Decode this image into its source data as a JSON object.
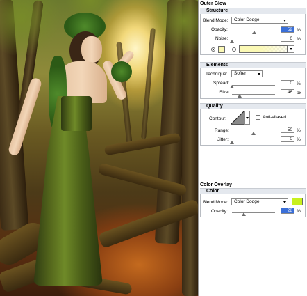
{
  "panel": {
    "outer_glow": {
      "title": "Outer Glow",
      "structure": {
        "header": "Structure",
        "blend_mode_label": "Blend Mode:",
        "blend_mode_value": "Color Dodge",
        "opacity_label": "Opacity:",
        "opacity_value": "52",
        "opacity_unit": "%",
        "opacity_level": 0.52,
        "noise_label": "Noise:",
        "noise_value": "0",
        "noise_unit": "%",
        "noise_level": 0,
        "glow_color": "#fbf9b5",
        "gradient_color": "#fbf9b5",
        "color_radio_selected": true
      },
      "elements": {
        "header": "Elements",
        "technique_label": "Technique:",
        "technique_value": "Softer",
        "spread_label": "Spread:",
        "spread_value": "0",
        "spread_unit": "%",
        "spread_level": 0,
        "size_label": "Size:",
        "size_value": "46",
        "size_unit": "px",
        "size_level": 0.18
      },
      "quality": {
        "header": "Quality",
        "contour_label": "Contour:",
        "anti_aliased_label": "Anti-aliased",
        "anti_aliased_checked": false,
        "range_label": "Range:",
        "range_value": "50",
        "range_unit": "%",
        "range_level": 0.5,
        "jitter_label": "Jitter:",
        "jitter_value": "0",
        "jitter_unit": "%",
        "jitter_level": 0
      }
    },
    "color_overlay": {
      "title": "Color Overlay",
      "header": "Color",
      "blend_mode_label": "Blend Mode:",
      "blend_mode_value": "Color Dodge",
      "overlay_color": "#c8f01e",
      "opacity_label": "Opacity:",
      "opacity_value": "28",
      "opacity_unit": "%",
      "opacity_level": 0.28
    }
  }
}
